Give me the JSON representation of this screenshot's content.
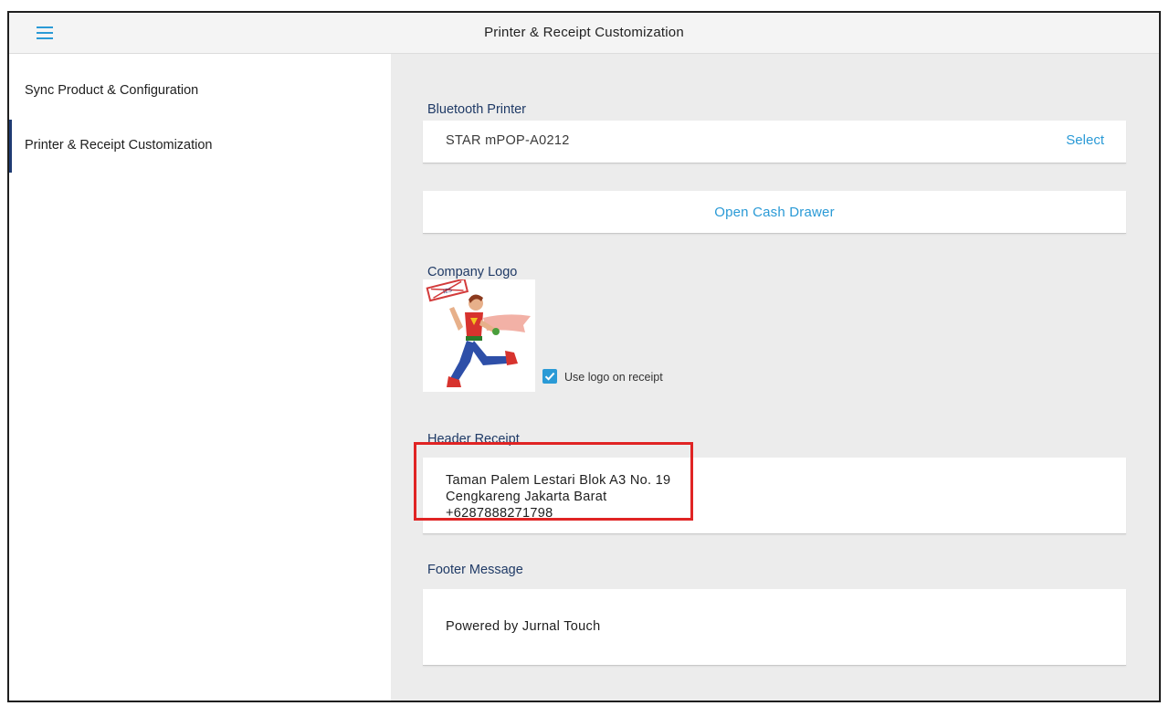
{
  "appbar": {
    "title": "Printer & Receipt Customization",
    "menu_icon": "hamburger-menu-icon"
  },
  "sidebar": {
    "items": [
      {
        "label": "Sync Product & Configuration",
        "active": false
      },
      {
        "label": "Printer & Receipt Customization",
        "active": true
      }
    ]
  },
  "bluetooth_printer": {
    "section_label": "Bluetooth Printer",
    "printer_name": "STAR mPOP-A0212",
    "select_label": "Select"
  },
  "cash_drawer": {
    "button_label": "Open Cash Drawer"
  },
  "company_logo": {
    "section_label": "Company Logo",
    "use_logo_label": "Use logo on receipt",
    "use_logo_checked": true
  },
  "header_receipt": {
    "section_label": "Header Receipt",
    "lines": [
      "Taman Palem Lestari Blok A3 No. 19",
      "Cengkareng Jakarta Barat",
      "+6287888271798"
    ]
  },
  "footer_message": {
    "section_label": "Footer Message",
    "text": "Powered by Jurnal Touch"
  },
  "colors": {
    "accent": "#2a9ad6",
    "section_label": "#1f3a66",
    "highlight": "#e02424",
    "main_bg": "#ececec"
  }
}
